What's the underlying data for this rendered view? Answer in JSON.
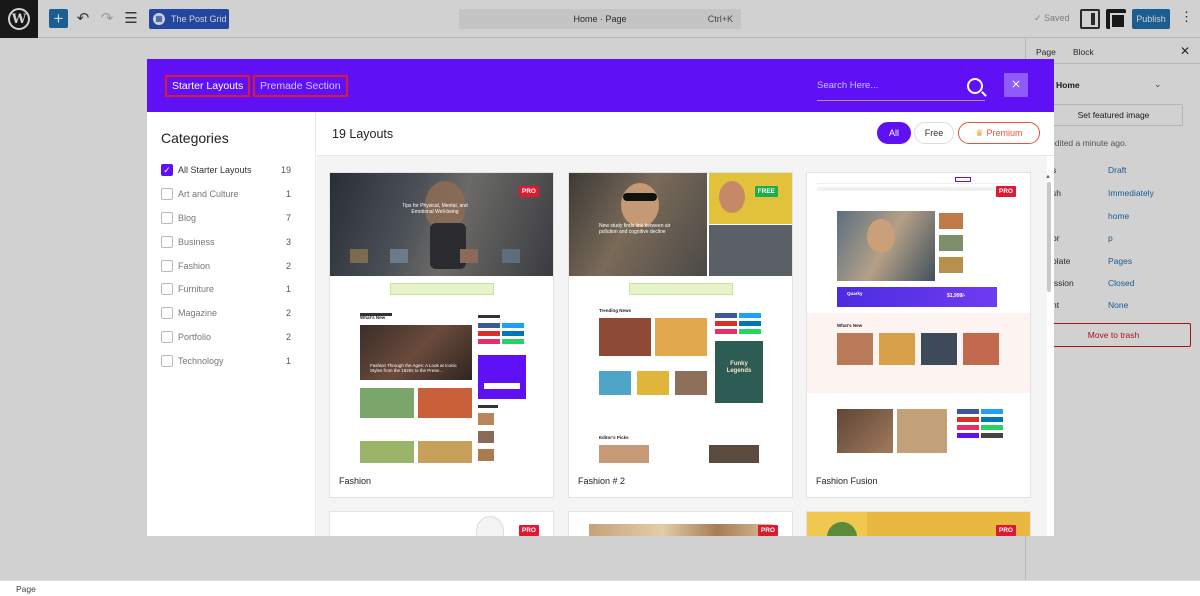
{
  "topbar": {
    "post_grid_label": "The Post Grid",
    "command_title": "Home · Page",
    "command_shortcut": "Ctrl+K",
    "saved_label": "Saved",
    "publish_label": "Publish"
  },
  "right_panel": {
    "tabs": [
      "Page",
      "Block"
    ],
    "page_title": "Home",
    "featured_image_label": "Set featured image",
    "edited_text": "edited a minute ago.",
    "rows": [
      {
        "key": "s",
        "value": "Draft"
      },
      {
        "key": "sh",
        "value": "Immediately"
      },
      {
        "key": "",
        "value": "home"
      },
      {
        "key": "or",
        "value": "p"
      },
      {
        "key": "plate",
        "value": "Pages"
      },
      {
        "key": "ission",
        "value": "Closed"
      },
      {
        "key": "nt",
        "value": "None"
      }
    ],
    "trash_label": "Move to trash"
  },
  "bottombar": {
    "label": "Page"
  },
  "modal": {
    "tabs": {
      "starter": "Starter Layouts",
      "premade": "Premade Section"
    },
    "search_placeholder": "Search Here...",
    "close_icon": "×",
    "categories_title": "Categories",
    "categories": [
      {
        "label": "All Starter Layouts",
        "count": "19",
        "checked": true
      },
      {
        "label": "Art and Culture",
        "count": "1"
      },
      {
        "label": "Blog",
        "count": "7"
      },
      {
        "label": "Business",
        "count": "3"
      },
      {
        "label": "Fashion",
        "count": "2"
      },
      {
        "label": "Furniture",
        "count": "1"
      },
      {
        "label": "Magazine",
        "count": "2"
      },
      {
        "label": "Portfolio",
        "count": "2"
      },
      {
        "label": "Technology",
        "count": "1"
      }
    ],
    "layouts_count": "19 Layouts",
    "filters": {
      "all": "All",
      "free": "Free",
      "premium": "Premium"
    },
    "cards": [
      {
        "name": "Fashion",
        "badge": "PRO"
      },
      {
        "name": "Fashion # 2",
        "badge": "FREE"
      },
      {
        "name": "Fashion Fusion",
        "badge": "PRO"
      },
      {
        "name": "",
        "badge": "PRO"
      },
      {
        "name": "",
        "badge": "PRO"
      },
      {
        "name": "",
        "badge": "PRO"
      }
    ],
    "thumb_text": {
      "fashion_hero": "Tips for Physical, Mental, and Emotional Well-being",
      "fashion_news": "What's New",
      "fashion_feature": "Fashion Through the Ages: A Look at Iconic Styles from the 1920s to the Prese...",
      "fashion2_hero": "New study finds link between air pollution and cognitive decline",
      "fashion2_trending": "Trending News",
      "fashion2_ad": "Funky Legends",
      "fashion2_editors": "Editor's Picks",
      "fusion_promo": "Quarky",
      "fusion_price": "$1,999/-",
      "fusion_whats_new": "What's New"
    }
  },
  "colors": {
    "modal_header": "#5f10f5",
    "wp_blue": "#2271b1",
    "pro_badge": "#e01830",
    "free_badge": "#1dae4b"
  }
}
